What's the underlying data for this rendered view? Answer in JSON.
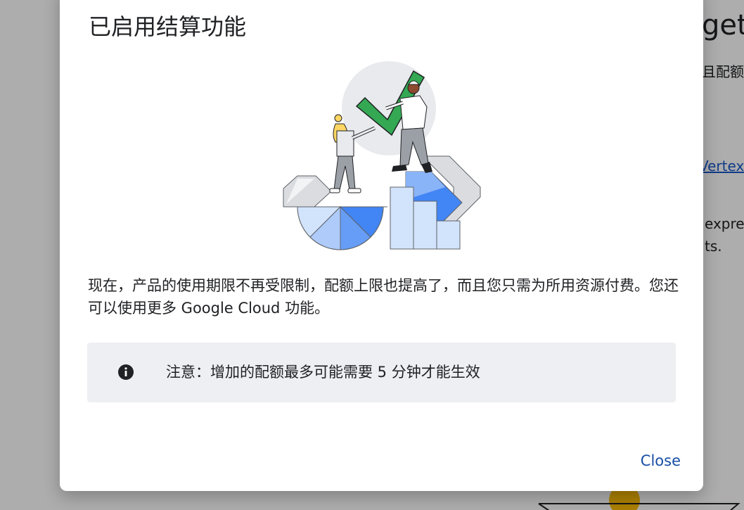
{
  "background": {
    "heading_fragment": "get",
    "text_fragment_1": "且配额",
    "link_fragment": "Vertex",
    "text_fragment_2": "expre\nts."
  },
  "dialog": {
    "title": "已启用结算功能",
    "body": "现在，产品的使用期限不再受限制，配额上限也提高了，而且您只需为所用资源付费。您还可以使用更多 Google Cloud 功能。",
    "notice": {
      "icon": "info-icon",
      "text": "注意：增加的配额最多可能需要 5 分钟才能生效"
    },
    "close_label": "Close"
  },
  "colors": {
    "accent": "#174ea6",
    "notice_bg": "#eeeff3",
    "check_green": "#2f9e4f",
    "blue_dark": "#4285f4",
    "blue_light": "#aecbfa"
  }
}
